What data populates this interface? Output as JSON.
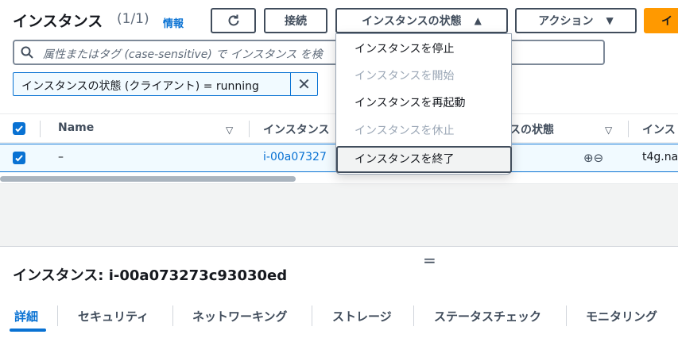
{
  "header": {
    "title": "インスタンス",
    "count": "(1/1)",
    "info_link": "情報",
    "buttons": {
      "connect": "接続",
      "instance_state": "インスタンスの状態",
      "actions": "アクション",
      "launch": "イ"
    }
  },
  "search": {
    "placeholder": "属性またはタグ (case-sensitive) で インスタンス を検"
  },
  "filter_token": {
    "label": "インスタンスの状態 (クライアント) = running"
  },
  "table": {
    "columns": [
      "Name",
      "インスタンス",
      "スの状態",
      "インス"
    ],
    "rows": [
      {
        "name": "–",
        "instance_id": "i-00a07327",
        "type": "t4g.na"
      }
    ]
  },
  "dropdown": {
    "items": [
      {
        "label": "インスタンスを停止",
        "state": "enabled"
      },
      {
        "label": "インスタンスを開始",
        "state": "disabled"
      },
      {
        "label": "インスタンスを再起動",
        "state": "enabled"
      },
      {
        "label": "インスタンスを休止",
        "state": "disabled"
      },
      {
        "label": "インスタンスを終了",
        "state": "highlighted"
      }
    ]
  },
  "details": {
    "title": "インスタンス: i-00a073273c93030ed",
    "handle": "=",
    "tabs": [
      "詳細",
      "セキュリティ",
      "ネットワーキング",
      "ストレージ",
      "ステータスチェック",
      "モニタリング"
    ]
  },
  "colors": {
    "accent": "#0972d3",
    "launch_button": "#ff9900",
    "selected_row": "#f1faff"
  }
}
